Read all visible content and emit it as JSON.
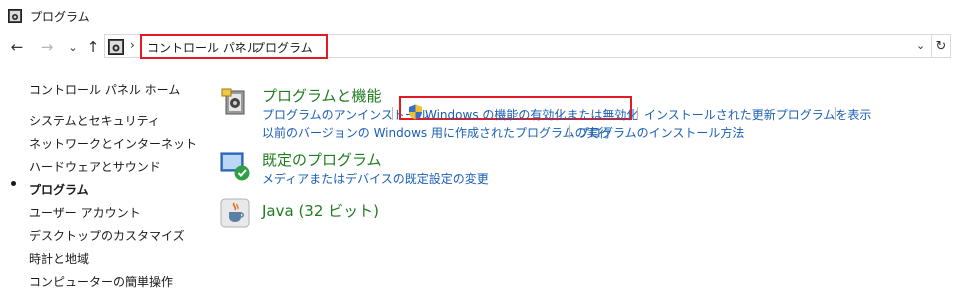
{
  "window": {
    "title": "プログラム"
  },
  "nav": {
    "back": "←",
    "forward": "→",
    "recent": "⌄",
    "up": "↑"
  },
  "address": {
    "separator": "›",
    "crumbs": [
      "コントロール パネル",
      "プログラム"
    ],
    "dropdown": "⌄",
    "refresh": "↻"
  },
  "sidebar": {
    "home": "コントロール パネル ホーム",
    "items": [
      {
        "label": "システムとセキュリティ"
      },
      {
        "label": "ネットワークとインターネット"
      },
      {
        "label": "ハードウェアとサウンド"
      },
      {
        "label": "プログラム",
        "selected": true
      },
      {
        "label": "ユーザー アカウント"
      },
      {
        "label": "デスクトップのカスタマイズ"
      },
      {
        "label": "時計と地域"
      },
      {
        "label": "コンピューターの簡単操作"
      }
    ]
  },
  "categories": [
    {
      "title": "プログラムと機能",
      "icon": "programs-features-icon",
      "links": [
        "プログラムのアンインストール",
        "Windows の機能の有効化または無効化",
        "インストールされた更新プログラムを表示",
        "以前のバージョンの Windows 用に作成されたプログラムの実行",
        "プログラムのインストール方法"
      ]
    },
    {
      "title": "既定のプログラム",
      "icon": "default-programs-icon",
      "links": [
        "メディアまたはデバイスの既定設定の変更"
      ]
    },
    {
      "title": "Java (32 ビット)",
      "icon": "java-icon",
      "links": []
    }
  ],
  "colors": {
    "link": "#1a5fb4",
    "category_title": "#1e7b1e",
    "highlight": "#e01b24"
  }
}
